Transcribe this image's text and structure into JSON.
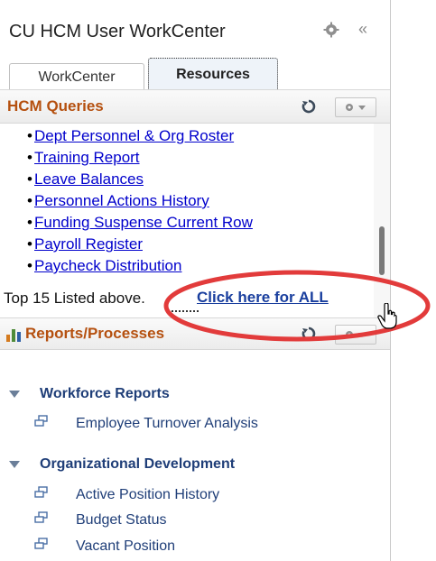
{
  "window": {
    "title": "CU HCM User WorkCenter",
    "collapse_glyph": "«",
    "settings_icon": "gear-icon"
  },
  "tabs": [
    {
      "label": "WorkCenter",
      "selected": false
    },
    {
      "label": "Resources",
      "selected": true
    }
  ],
  "queries": {
    "title": "HCM Queries",
    "items": [
      "Dept Personnel & Org Roster",
      "Training Report",
      "Leave Balances",
      "Personnel Actions History",
      "Funding Suspense Current Row",
      "Payroll Register",
      "Paycheck Distribution"
    ],
    "footer_text": "Top 15 Listed above.",
    "footer_link": "Click here for ALL"
  },
  "reports": {
    "title": "Reports/Processes",
    "groups": [
      {
        "label": "Workforce Reports",
        "items": [
          "Employee Turnover Analysis"
        ]
      },
      {
        "label": "Organizational Development",
        "items": [
          "Active Position History",
          "Budget Status",
          "Vacant Position"
        ]
      }
    ]
  },
  "colors": {
    "section_title": "#b5500f",
    "link": "#0000cc",
    "group_label": "#1f3e78",
    "highlight": "#e23b3b"
  }
}
